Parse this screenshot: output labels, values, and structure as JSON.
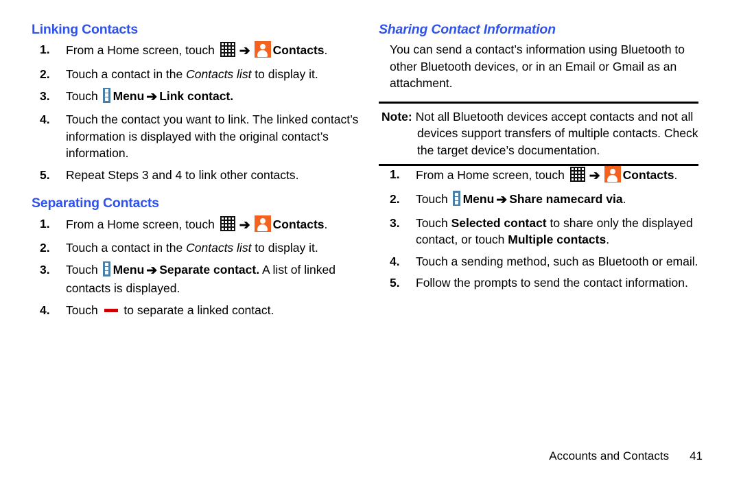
{
  "document": {
    "footer": {
      "chapter": "Accounts and Contacts",
      "page_number": "41"
    }
  },
  "colors": {
    "heading_blue": "#2f52ed",
    "contacts_icon_orange": "#f4621f",
    "menu_icon_blue": "#4a7fa8",
    "separate_icon_red": "#cc0000"
  },
  "icons": {
    "apps": "apps-grid-icon",
    "contacts": "contacts-app-icon",
    "menu": "menu-three-dots-icon",
    "arrow": "➔",
    "separate": "separate-minus-icon"
  },
  "left_column": {
    "sections": [
      {
        "heading": "Linking Contacts",
        "steps": [
          {
            "num": "1.",
            "parts": [
              {
                "t": "text",
                "v": "From a Home screen, touch "
              },
              {
                "t": "icon",
                "v": "apps"
              },
              {
                "t": "icon",
                "v": "arrow"
              },
              {
                "t": "icon",
                "v": "contacts"
              },
              {
                "t": "bold",
                "v": "Contacts"
              },
              {
                "t": "text",
                "v": "."
              }
            ]
          },
          {
            "num": "2.",
            "parts": [
              {
                "t": "text",
                "v": "Touch a contact in the "
              },
              {
                "t": "italic",
                "v": "Contacts list"
              },
              {
                "t": "text",
                "v": " to display it."
              }
            ]
          },
          {
            "num": "3.",
            "parts": [
              {
                "t": "text",
                "v": "Touch "
              },
              {
                "t": "icon",
                "v": "menu"
              },
              {
                "t": "bold",
                "v": "Menu"
              },
              {
                "t": "icon",
                "v": "arrow"
              },
              {
                "t": "bold",
                "v": "Link contact."
              }
            ]
          },
          {
            "num": "4.",
            "parts": [
              {
                "t": "text",
                "v": "Touch the contact you want to link. The linked contact’s information is displayed with the original contact’s information."
              }
            ]
          },
          {
            "num": "5.",
            "parts": [
              {
                "t": "text",
                "v": "Repeat Steps 3 and 4 to link other contacts."
              }
            ]
          }
        ]
      },
      {
        "heading": "Separating Contacts",
        "steps": [
          {
            "num": "1.",
            "parts": [
              {
                "t": "text",
                "v": "From a Home screen, touch "
              },
              {
                "t": "icon",
                "v": "apps"
              },
              {
                "t": "icon",
                "v": "arrow"
              },
              {
                "t": "icon",
                "v": "contacts"
              },
              {
                "t": "bold",
                "v": "Contacts"
              },
              {
                "t": "text",
                "v": "."
              }
            ]
          },
          {
            "num": "2.",
            "parts": [
              {
                "t": "text",
                "v": "Touch a contact in the "
              },
              {
                "t": "italic",
                "v": "Contacts list"
              },
              {
                "t": "text",
                "v": " to display it."
              }
            ]
          },
          {
            "num": "3.",
            "parts": [
              {
                "t": "text",
                "v": "Touch "
              },
              {
                "t": "icon",
                "v": "menu"
              },
              {
                "t": "bold",
                "v": "Menu"
              },
              {
                "t": "icon",
                "v": "arrow"
              },
              {
                "t": "bold",
                "v": "Separate contact."
              },
              {
                "t": "text",
                "v": " A list of linked contacts is displayed."
              }
            ]
          },
          {
            "num": "4.",
            "parts": [
              {
                "t": "text",
                "v": "Touch "
              },
              {
                "t": "icon",
                "v": "separate"
              },
              {
                "t": "text",
                "v": " to separate a linked contact."
              }
            ]
          }
        ]
      }
    ]
  },
  "right_column": {
    "heading": "Sharing Contact Information",
    "intro": "You can send a contact’s information using Bluetooth to other Bluetooth devices, or in an Email or Gmail as an attachment.",
    "note": {
      "label": "Note:",
      "text": "Not all Bluetooth devices accept contacts and not all devices support transfers of multiple contacts. Check the target device’s documentation."
    },
    "steps": [
      {
        "num": "1.",
        "parts": [
          {
            "t": "text",
            "v": "From a Home screen, touch "
          },
          {
            "t": "icon",
            "v": "apps"
          },
          {
            "t": "icon",
            "v": "arrow"
          },
          {
            "t": "icon",
            "v": "contacts"
          },
          {
            "t": "bold",
            "v": "Contacts"
          },
          {
            "t": "text",
            "v": "."
          }
        ]
      },
      {
        "num": "2.",
        "parts": [
          {
            "t": "text",
            "v": "Touch "
          },
          {
            "t": "icon",
            "v": "menu"
          },
          {
            "t": "bold",
            "v": "Menu"
          },
          {
            "t": "icon",
            "v": "arrow"
          },
          {
            "t": "bold",
            "v": "Share namecard via"
          },
          {
            "t": "text",
            "v": "."
          }
        ]
      },
      {
        "num": "3.",
        "parts": [
          {
            "t": "text",
            "v": "Touch "
          },
          {
            "t": "bold",
            "v": "Selected contact"
          },
          {
            "t": "text",
            "v": " to share only the displayed contact, or touch "
          },
          {
            "t": "bold",
            "v": "Multiple contacts"
          },
          {
            "t": "text",
            "v": "."
          }
        ]
      },
      {
        "num": "4.",
        "parts": [
          {
            "t": "text",
            "v": "Touch a sending method, such as Bluetooth or email."
          }
        ]
      },
      {
        "num": "5.",
        "parts": [
          {
            "t": "text",
            "v": "Follow the prompts to send the contact information."
          }
        ]
      }
    ]
  }
}
